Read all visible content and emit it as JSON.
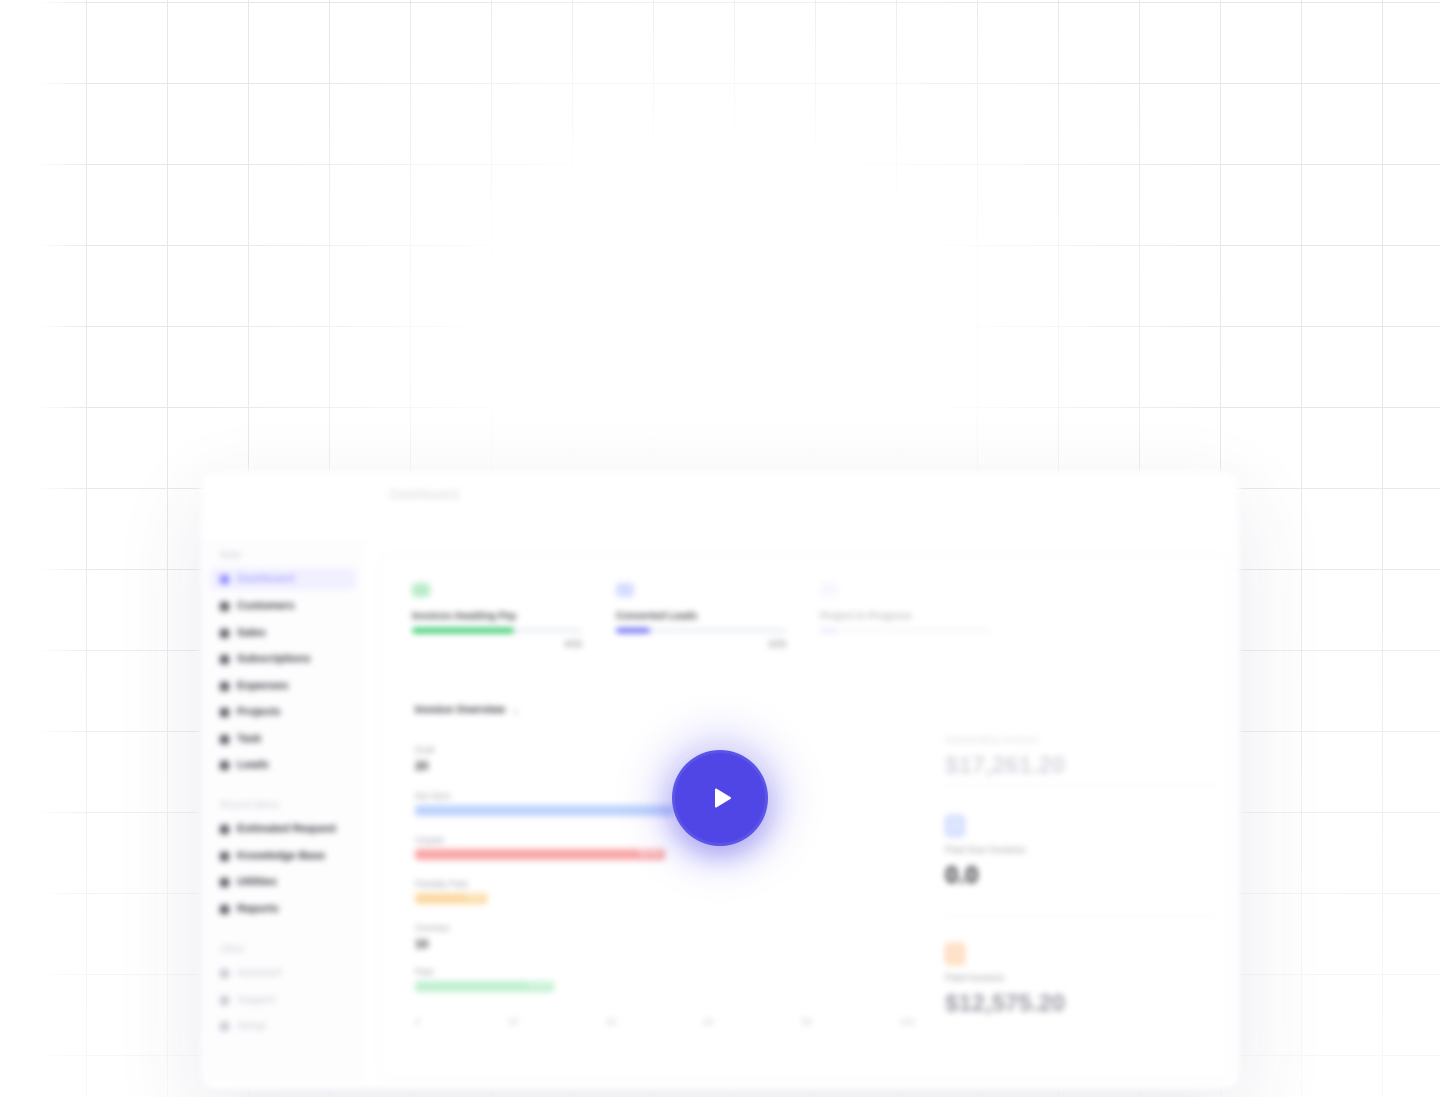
{
  "background": {
    "grid_color": "#e6e7ec"
  },
  "dashboard": {
    "title": "Dashboard",
    "sidebar": {
      "sections": [
        {
          "label": "Main",
          "items": [
            {
              "label": "Dashboard",
              "icon": "grid-icon",
              "active": true
            },
            {
              "label": "Customers",
              "icon": "users-icon"
            },
            {
              "label": "Sales",
              "icon": "cart-icon"
            },
            {
              "label": "Subscriptions",
              "icon": "repeat-icon"
            },
            {
              "label": "Expenses",
              "icon": "receipt-icon"
            },
            {
              "label": "Projects",
              "icon": "folder-icon"
            },
            {
              "label": "Task",
              "icon": "check-icon"
            },
            {
              "label": "Leads",
              "icon": "target-icon"
            }
          ]
        },
        {
          "label": "Recent Menu",
          "items": [
            {
              "label": "Estimated Request",
              "icon": "file-icon"
            },
            {
              "label": "Knowledge Base",
              "icon": "book-icon"
            },
            {
              "label": "Utilities",
              "icon": "tool-icon"
            },
            {
              "label": "Reports",
              "icon": "chart-icon"
            }
          ]
        },
        {
          "label": "Other",
          "items": [
            {
              "label": "Assistant",
              "icon": "bot-icon"
            },
            {
              "label": "Support",
              "icon": "help-icon"
            },
            {
              "label": "Setup",
              "icon": "gear-icon"
            }
          ]
        }
      ]
    },
    "stats": [
      {
        "label": "Invoices Awaiting Pay",
        "value": "4/15",
        "progress": 0.6,
        "color": "#22c55e"
      },
      {
        "label": "Converted Leads",
        "value": "2/15",
        "progress": 0.2,
        "color": "#6366f1"
      },
      {
        "label": "Project In Progress",
        "value": "",
        "progress": 0.1,
        "color": "#c7c8ff"
      }
    ],
    "chart": {
      "title": "Invoice Overview",
      "rows": [
        {
          "label": "Draft",
          "number": "20",
          "bar": 0,
          "color": ""
        },
        {
          "label": "Not Sent",
          "number": "",
          "bar": 0.54,
          "color": "#bcd3fb"
        },
        {
          "label": "Unpaid",
          "number": "",
          "bar": 0.52,
          "color": "#f9a5a5",
          "tag": "$8,500"
        },
        {
          "label": "Partially Paid",
          "number": "",
          "bar": 0.15,
          "color": "#fcd9a1",
          "tag": "$500"
        },
        {
          "label": "Overdue",
          "number": "10",
          "bar": 0,
          "color": ""
        },
        {
          "label": "Paid",
          "number": "",
          "bar": 0.29,
          "color": "#bff0cf",
          "tag": "$2,000"
        }
      ],
      "axis": [
        "0",
        "20",
        "40",
        "60",
        "80",
        "100"
      ]
    },
    "right_panel": {
      "total_label": "Outstanding Invoices",
      "total_value": "$17,261.20",
      "overdue_label": "Past Due Invoices",
      "overdue_value": "0.0",
      "paid_label": "Paid Invoices",
      "paid_value": "$12,575.20"
    }
  },
  "play": {
    "icon": "play-icon",
    "color": "#4f46e5"
  }
}
